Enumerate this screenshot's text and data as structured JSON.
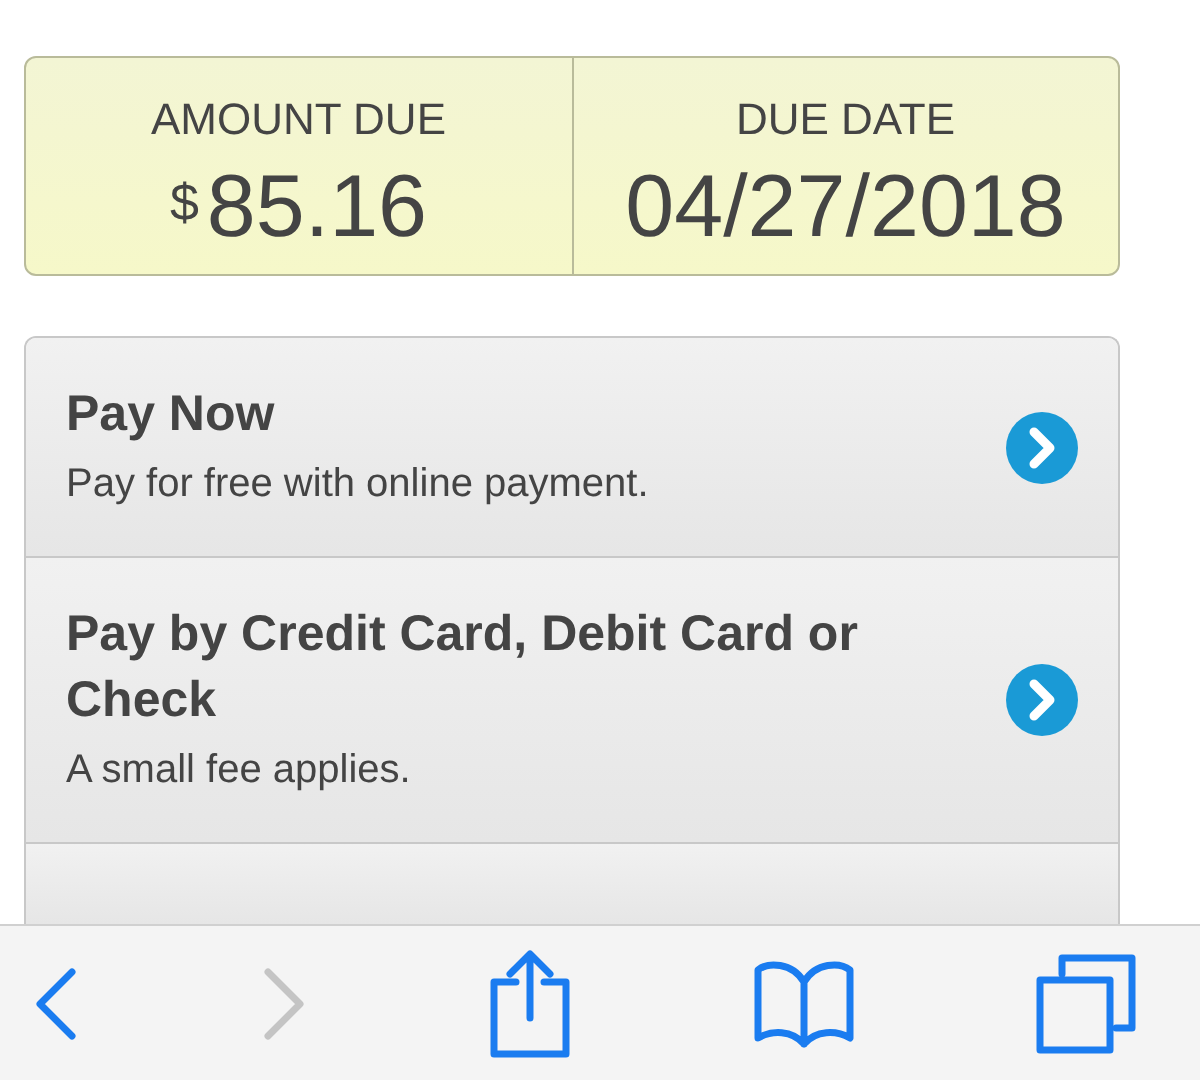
{
  "summary": {
    "amount": {
      "label": "AMOUNT DUE",
      "currency_symbol": "$",
      "value": "85.16"
    },
    "due_date": {
      "label": "DUE DATE",
      "value": "04/27/2018"
    }
  },
  "options": [
    {
      "title": "Pay Now",
      "subtitle": "Pay for free with online payment."
    },
    {
      "title": "Pay by Credit Card, Debit Card or Check",
      "subtitle": "A small fee applies."
    }
  ],
  "has_more_options": true,
  "toolbar": [
    {
      "kind": "back",
      "disabled": false
    },
    {
      "kind": "forward",
      "disabled": true
    },
    {
      "kind": "share",
      "disabled": false
    },
    {
      "kind": "bookmarks",
      "disabled": false
    },
    {
      "kind": "tabs",
      "disabled": false
    }
  ]
}
